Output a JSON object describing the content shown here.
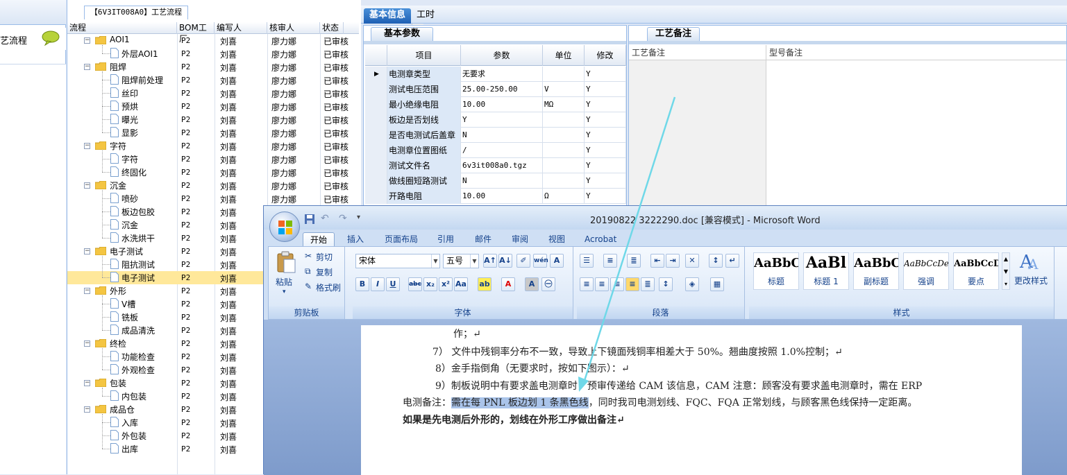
{
  "left_nav": {
    "item_label": "艺流程"
  },
  "process_panel": {
    "title": "【6V3IT008A0】工艺流程",
    "columns": {
      "flow": "流程",
      "bom": "BOM工厂",
      "writer": "编写人",
      "reviewer": "核审人",
      "status": "状态"
    },
    "rows": [
      {
        "level": 0,
        "name": "AOI1",
        "bom": "P2",
        "writer": "刘喜",
        "reviewer": "廖力娜",
        "status": "已审核"
      },
      {
        "level": 1,
        "name": "外层AOI1",
        "bom": "P2",
        "writer": "刘喜",
        "reviewer": "廖力娜",
        "status": "已审核"
      },
      {
        "level": 0,
        "name": "阻焊",
        "bom": "P2",
        "writer": "刘喜",
        "reviewer": "廖力娜",
        "status": "已审核"
      },
      {
        "level": 1,
        "name": "阻焊前处理",
        "bom": "P2",
        "writer": "刘喜",
        "reviewer": "廖力娜",
        "status": "已审核"
      },
      {
        "level": 1,
        "name": "丝印",
        "bom": "P2",
        "writer": "刘喜",
        "reviewer": "廖力娜",
        "status": "已审核"
      },
      {
        "level": 1,
        "name": "预烘",
        "bom": "P2",
        "writer": "刘喜",
        "reviewer": "廖力娜",
        "status": "已审核"
      },
      {
        "level": 1,
        "name": "曝光",
        "bom": "P2",
        "writer": "刘喜",
        "reviewer": "廖力娜",
        "status": "已审核"
      },
      {
        "level": 1,
        "name": "显影",
        "bom": "P2",
        "writer": "刘喜",
        "reviewer": "廖力娜",
        "status": "已审核"
      },
      {
        "level": 0,
        "name": "字符",
        "bom": "P2",
        "writer": "刘喜",
        "reviewer": "廖力娜",
        "status": "已审核"
      },
      {
        "level": 1,
        "name": "字符",
        "bom": "P2",
        "writer": "刘喜",
        "reviewer": "廖力娜",
        "status": "已审核"
      },
      {
        "level": 1,
        "name": "终固化",
        "bom": "P2",
        "writer": "刘喜",
        "reviewer": "廖力娜",
        "status": "已审核"
      },
      {
        "level": 0,
        "name": "沉金",
        "bom": "P2",
        "writer": "刘喜",
        "reviewer": "廖力娜",
        "status": "已审核"
      },
      {
        "level": 1,
        "name": "喷砂",
        "bom": "P2",
        "writer": "刘喜",
        "reviewer": "廖力娜",
        "status": "已审核"
      },
      {
        "level": 1,
        "name": "板边包胶",
        "bom": "P2",
        "writer": "刘喜",
        "reviewer": "",
        "status": ""
      },
      {
        "level": 1,
        "name": "沉金",
        "bom": "P2",
        "writer": "刘喜",
        "reviewer": "",
        "status": ""
      },
      {
        "level": 1,
        "name": "水洗烘干",
        "bom": "P2",
        "writer": "刘喜",
        "reviewer": "",
        "status": ""
      },
      {
        "level": 0,
        "name": "电子测试",
        "bom": "P2",
        "writer": "刘喜",
        "reviewer": "",
        "status": ""
      },
      {
        "level": 1,
        "name": "阻抗测试",
        "bom": "P2",
        "writer": "刘喜",
        "reviewer": "",
        "status": ""
      },
      {
        "level": 1,
        "name": "电子测试",
        "bom": "P2",
        "writer": "刘喜",
        "reviewer": "",
        "status": "",
        "selected": true
      },
      {
        "level": 0,
        "name": "外形",
        "bom": "P2",
        "writer": "刘喜",
        "reviewer": "",
        "status": ""
      },
      {
        "level": 1,
        "name": "V槽",
        "bom": "P2",
        "writer": "刘喜",
        "reviewer": "",
        "status": ""
      },
      {
        "level": 1,
        "name": "铣板",
        "bom": "P2",
        "writer": "刘喜",
        "reviewer": "",
        "status": ""
      },
      {
        "level": 1,
        "name": "成品清洗",
        "bom": "P2",
        "writer": "刘喜",
        "reviewer": "",
        "status": ""
      },
      {
        "level": 0,
        "name": "终检",
        "bom": "P2",
        "writer": "刘喜",
        "reviewer": "",
        "status": ""
      },
      {
        "level": 1,
        "name": "功能检查",
        "bom": "P2",
        "writer": "刘喜",
        "reviewer": "",
        "status": ""
      },
      {
        "level": 1,
        "name": "外观检查",
        "bom": "P2",
        "writer": "刘喜",
        "reviewer": "",
        "status": ""
      },
      {
        "level": 0,
        "name": "包装",
        "bom": "P2",
        "writer": "刘喜",
        "reviewer": "",
        "status": ""
      },
      {
        "level": 1,
        "name": "内包装",
        "bom": "P2",
        "writer": "刘喜",
        "reviewer": "",
        "status": ""
      },
      {
        "level": 0,
        "name": "成品仓",
        "bom": "P2",
        "writer": "刘喜",
        "reviewer": "",
        "status": ""
      },
      {
        "level": 1,
        "name": "入库",
        "bom": "P2",
        "writer": "刘喜",
        "reviewer": "",
        "status": ""
      },
      {
        "level": 1,
        "name": "外包装",
        "bom": "P2",
        "writer": "刘喜",
        "reviewer": "",
        "status": ""
      },
      {
        "level": 1,
        "name": "出库",
        "bom": "P2",
        "writer": "刘喜",
        "reviewer": "",
        "status": ""
      }
    ]
  },
  "top_tabs": [
    "基本信息",
    "工时"
  ],
  "basic_params": {
    "tab": "基本参数",
    "columns": {
      "item": "项目",
      "param": "参数",
      "unit": "单位",
      "modify": "修改"
    },
    "rows": [
      {
        "item": "电测章类型",
        "param": "无要求",
        "unit": "",
        "modify": "Y"
      },
      {
        "item": "测试电压范围",
        "param": "25.00-250.00",
        "unit": "V",
        "modify": "Y"
      },
      {
        "item": "最小绝缘电阻",
        "param": "10.00",
        "unit": "MΩ",
        "modify": "Y"
      },
      {
        "item": "板边是否划线",
        "param": "Y",
        "unit": "",
        "modify": "Y"
      },
      {
        "item": "是否电测试后盖章",
        "param": "N",
        "unit": "",
        "modify": "Y"
      },
      {
        "item": "电测章位置图纸",
        "param": "/",
        "unit": "",
        "modify": "Y"
      },
      {
        "item": "测试文件名",
        "param": "6v3it008a0.tgz",
        "unit": "",
        "modify": "Y"
      },
      {
        "item": "做线圈短路测试",
        "param": "N",
        "unit": "",
        "modify": "Y"
      },
      {
        "item": "开路电阻",
        "param": "10.00",
        "unit": "Ω",
        "modify": "Y"
      }
    ]
  },
  "process_notes": {
    "tab": "工艺备注",
    "columns": {
      "process_note": "工艺备注",
      "model_note": "型号备注"
    }
  },
  "word": {
    "title": "20190822 3222290.doc [兼容模式] - Microsoft Word",
    "tabs": [
      "开始",
      "插入",
      "页面布局",
      "引用",
      "邮件",
      "审阅",
      "视图",
      "Acrobat"
    ],
    "clipboard": {
      "paste": "粘贴",
      "cut": "剪切",
      "copy": "复制",
      "format_painter": "格式刷",
      "label": "剪贴板"
    },
    "font": {
      "name": "宋体",
      "size": "五号",
      "label": "字体"
    },
    "paragraph": {
      "label": "段落"
    },
    "styles": {
      "label": "样式",
      "items": [
        {
          "sample": "AaBbC",
          "name": "标题"
        },
        {
          "sample": "AaBl",
          "name": "标题 1"
        },
        {
          "sample": "AaBbC",
          "name": "副标题"
        },
        {
          "sample": "AaBbCcDe",
          "name": "强调"
        },
        {
          "sample": "AaBbCcD",
          "name": "要点"
        }
      ],
      "change": "更改样式"
    },
    "doc_lines": {
      "l0": "作；↵",
      "l7": "7） 文件中残铜率分布不一致，导致上下镜面残铜率相差大于 50%。翘曲度按照 1.0%控制；↵",
      "l8": "8）金手指倒角（无要求时，按如下图示）：↵",
      "l9": "9）制板说明中有要求盖电测章时，预审传递给 CAM 该信息，CAM 注意：顾客没有要求盖电测章时，需在 ERP",
      "l10a": "电测备注：",
      "l10b": "需在每 PNL 板边划 1 条黑色线",
      "l10c": "，同时我司电测划线、FQC、FQA 正常划线，与顾客黑色线保持一定距离。",
      "l11": "如果是先电测后外形的，划线在外形工序做出备注↵"
    }
  },
  "colors": {
    "selection": "#ffe89a",
    "highlight": "#aac4ea",
    "arrow": "#6fd8e8",
    "ribbon_text": "#15428b"
  }
}
